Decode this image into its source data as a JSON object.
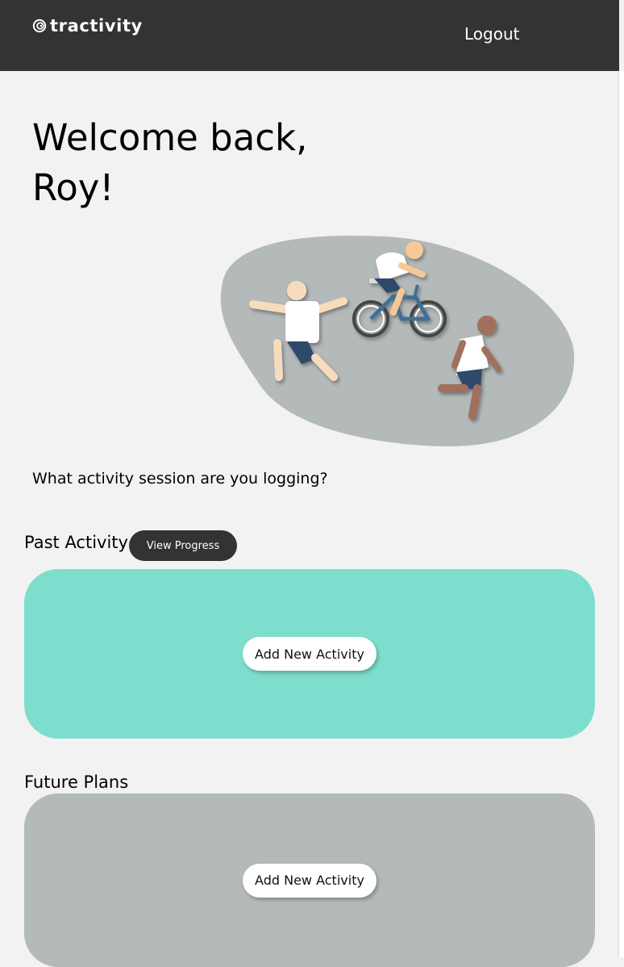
{
  "header": {
    "logo_text": "tractivity",
    "logout_label": "Logout"
  },
  "welcome": {
    "line1": "Welcome back,",
    "line2": "Roy!"
  },
  "prompt": "What activity session are you logging?",
  "past": {
    "title": "Past Activity",
    "view_progress_label": "View Progress",
    "add_label": "Add New Activity"
  },
  "future": {
    "title": "Future Plans",
    "add_label": "Add New Activity"
  },
  "colors": {
    "header_bg": "#333333",
    "past_panel": "#7ddecd",
    "future_panel": "#b4b9b9",
    "page_bg": "#f2f2f2"
  },
  "icons": [
    "swirl-logo-icon",
    "fitness-illustration"
  ]
}
